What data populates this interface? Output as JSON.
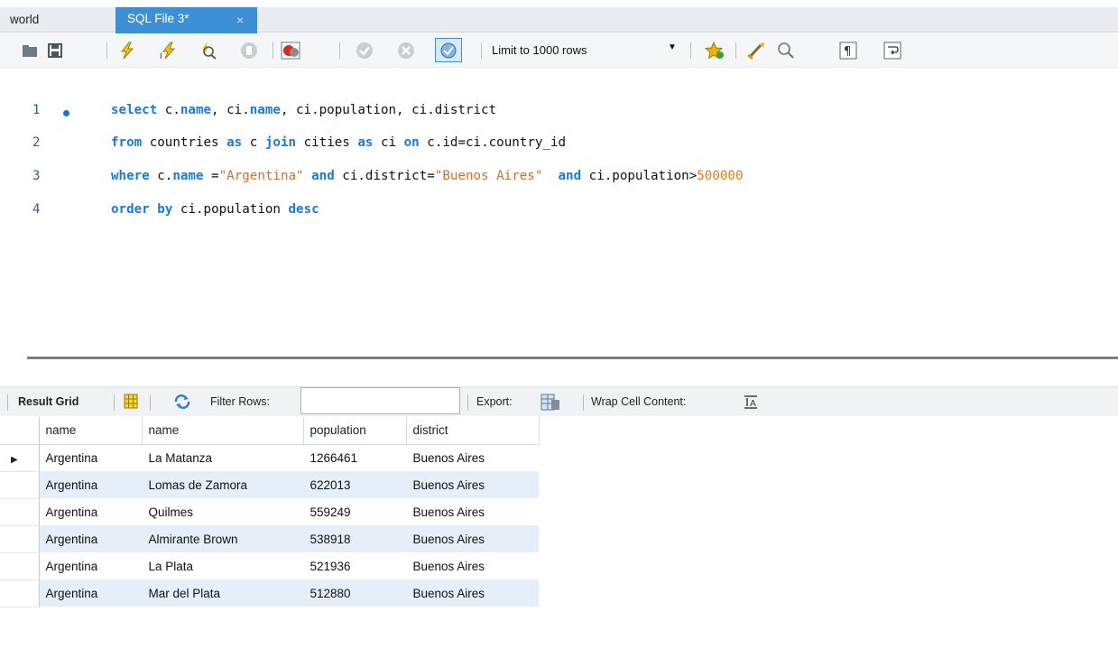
{
  "tabs": {
    "inactive_label": "world",
    "active_label": "SQL File 3*",
    "close_glyph": "×"
  },
  "toolbar": {
    "limit_label": "Limit to 1000 rows",
    "icons": [
      "folder-open-icon",
      "save-icon",
      "execute-icon",
      "execute-statement-icon",
      "explain-icon",
      "stop-icon",
      "error-toggle-icon",
      "commit-icon",
      "rollback-icon",
      "autocommit-icon",
      "limit-dropdown",
      "bookmark-icon",
      "beautify-icon",
      "find-icon",
      "invisible-chars-icon",
      "word-wrap-icon"
    ]
  },
  "editor": {
    "line_numbers": [
      "1",
      "2",
      "3",
      "4"
    ]
  },
  "results": {
    "result_grid_label": "Result Grid",
    "filter_rows_label": "Filter Rows:",
    "filter_value": "",
    "export_label": "Export:",
    "wrap_label": "Wrap Cell Content:",
    "columns": [
      "name",
      "name",
      "population",
      "district"
    ],
    "rows": [
      [
        "Argentina",
        "La Matanza",
        "1266461",
        "Buenos Aires"
      ],
      [
        "Argentina",
        "Lomas de Zamora",
        "622013",
        "Buenos Aires"
      ],
      [
        "Argentina",
        "Quilmes",
        "559249",
        "Buenos Aires"
      ],
      [
        "Argentina",
        "Almirante Brown",
        "538918",
        "Buenos Aires"
      ],
      [
        "Argentina",
        "La Plata",
        "521936",
        "Buenos Aires"
      ],
      [
        "Argentina",
        "Mar del Plata",
        "512880",
        "Buenos Aires"
      ]
    ]
  },
  "colors": {
    "active_tab": "#3d8fd6",
    "keyword": "#1a7ad8",
    "string": "#d96c28",
    "alt_row": "#e5effa"
  }
}
